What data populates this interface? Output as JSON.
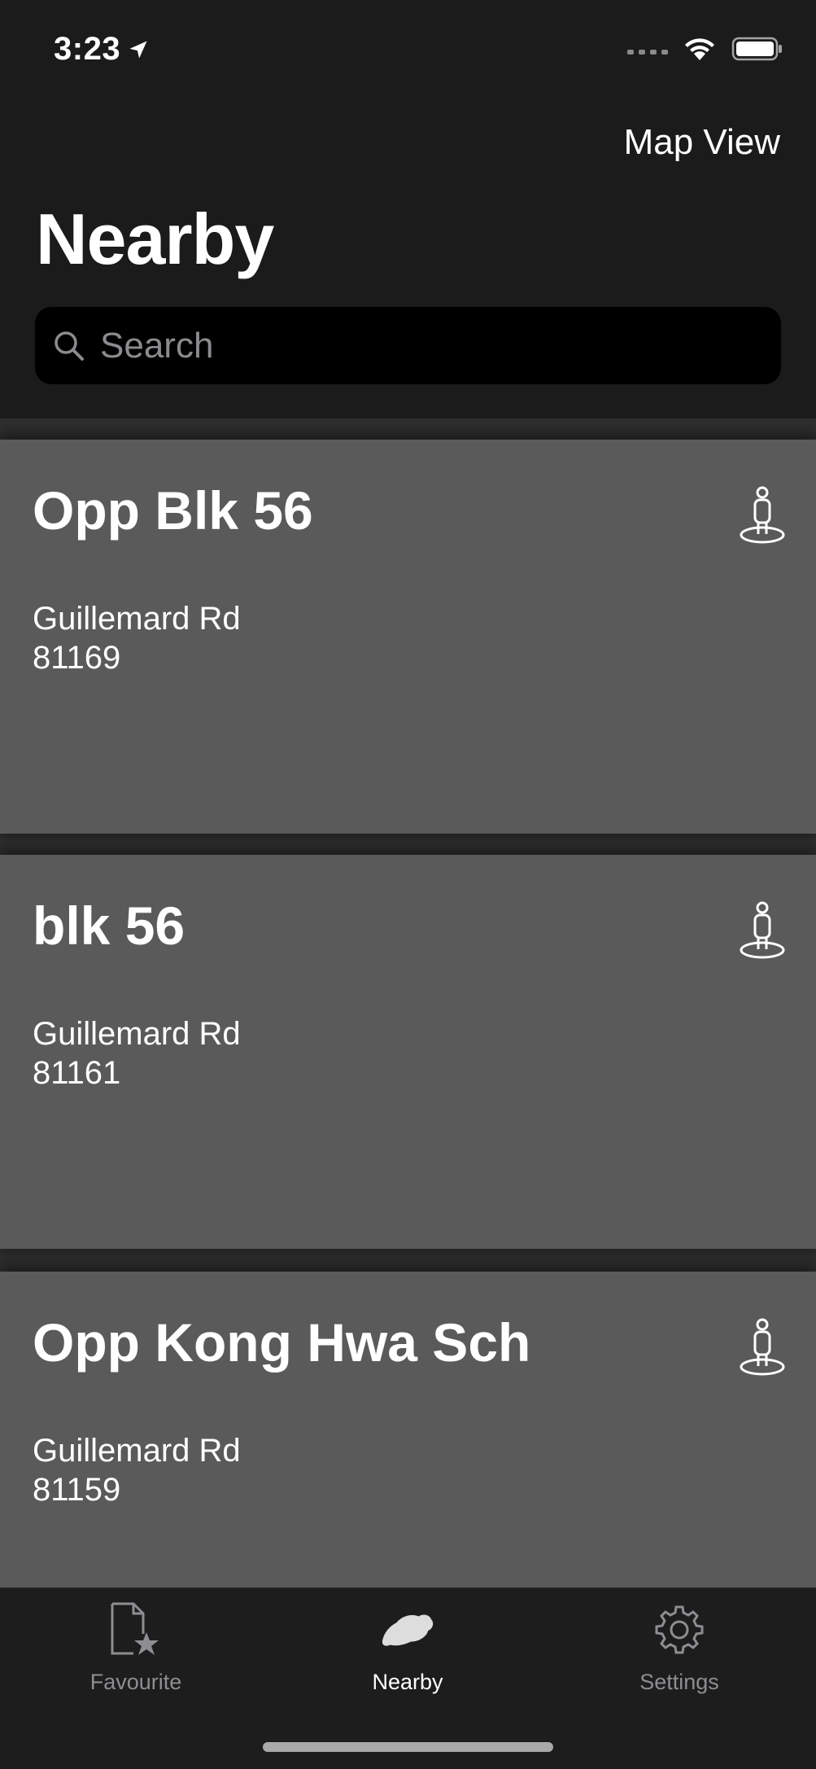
{
  "status_bar": {
    "time": "3:23",
    "location_icon": "location-arrow-icon",
    "signal_icon": "signal-dots-icon",
    "wifi_icon": "wifi-icon",
    "battery_icon": "battery-icon"
  },
  "header": {
    "map_view_label": "Map View",
    "title": "Nearby"
  },
  "search": {
    "placeholder": "Search",
    "icon": "search-icon"
  },
  "stops": [
    {
      "name": "Opp Blk 56",
      "road": "Guillemard Rd",
      "code": "81169",
      "icon": "walking-person-icon"
    },
    {
      "name": "blk 56",
      "road": "Guillemard Rd",
      "code": "81161",
      "icon": "walking-person-icon"
    },
    {
      "name": "Opp Kong Hwa Sch",
      "road": "Guillemard Rd",
      "code": "81159",
      "icon": "walking-person-icon"
    }
  ],
  "tabs": [
    {
      "label": "Favourite",
      "icon": "favourite-doc-star-icon",
      "active": false
    },
    {
      "label": "Nearby",
      "icon": "map-island-icon",
      "active": true
    },
    {
      "label": "Settings",
      "icon": "gear-icon",
      "active": false
    }
  ],
  "colors": {
    "background": "#1b1b1c",
    "card": "#5a5a5a",
    "search_bg": "#000000",
    "tab_inactive": "#8e8e92",
    "tab_active": "#ffffff"
  }
}
